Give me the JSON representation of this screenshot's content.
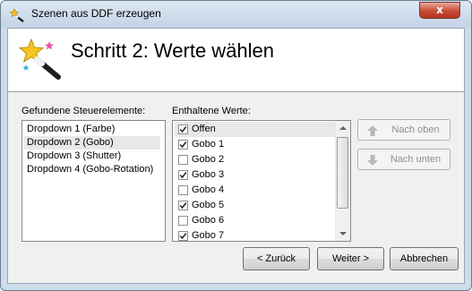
{
  "window": {
    "title": "Szenen aus DDF erzeugen",
    "close_glyph": "x",
    "title_icon": "wand-icon"
  },
  "header": {
    "heading": "Schritt 2: Werte wählen",
    "icon": "magic-wand-icon"
  },
  "controls": {
    "label": "Gefundene Steuerelemente:",
    "items": [
      {
        "label": "Dropdown 1 (Farbe)",
        "selected": false
      },
      {
        "label": "Dropdown 2 (Gobo)",
        "selected": true
      },
      {
        "label": "Dropdown 3 (Shutter)",
        "selected": false
      },
      {
        "label": "Dropdown 4 (Gobo-Rotation)",
        "selected": false
      }
    ]
  },
  "values": {
    "label": "Enthaltene Werte:",
    "items": [
      {
        "label": "Offen",
        "checked": true,
        "selected": true
      },
      {
        "label": "Gobo 1",
        "checked": true,
        "selected": false
      },
      {
        "label": "Gobo 2",
        "checked": false,
        "selected": false
      },
      {
        "label": "Gobo 3",
        "checked": true,
        "selected": false
      },
      {
        "label": "Gobo 4",
        "checked": false,
        "selected": false
      },
      {
        "label": "Gobo 5",
        "checked": true,
        "selected": false
      },
      {
        "label": "Gobo 6",
        "checked": false,
        "selected": false
      },
      {
        "label": "Gobo 7",
        "checked": true,
        "selected": false
      }
    ]
  },
  "side_buttons": {
    "up_label": "Nach oben",
    "down_label": "Nach unten"
  },
  "footer": {
    "back_label": "< Zurück",
    "next_label": "Weiter >",
    "cancel_label": "Abbrechen"
  }
}
